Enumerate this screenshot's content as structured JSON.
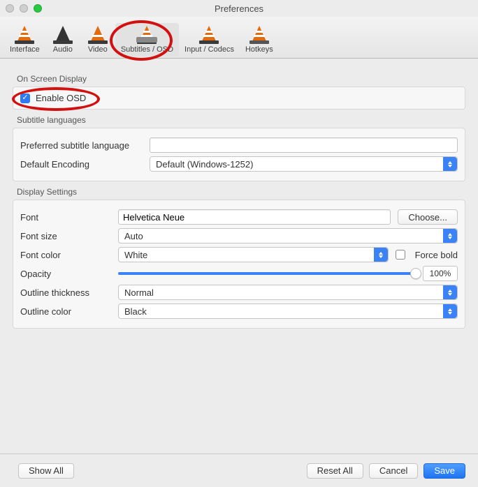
{
  "window": {
    "title": "Preferences"
  },
  "toolbar": {
    "items": [
      {
        "label": "Interface"
      },
      {
        "label": "Audio"
      },
      {
        "label": "Video"
      },
      {
        "label": "Subtitles / OSD"
      },
      {
        "label": "Input / Codecs"
      },
      {
        "label": "Hotkeys"
      }
    ],
    "selected_index": 3
  },
  "sections": {
    "osd": {
      "title": "On Screen Display",
      "enable_label": "Enable OSD",
      "enable_checked": true
    },
    "langs": {
      "title": "Subtitle languages",
      "pref_label": "Preferred subtitle language",
      "pref_value": "",
      "enc_label": "Default Encoding",
      "enc_value": "Default (Windows-1252)"
    },
    "display": {
      "title": "Display Settings",
      "font_label": "Font",
      "font_value": "Helvetica Neue",
      "choose_label": "Choose...",
      "size_label": "Font size",
      "size_value": "Auto",
      "color_label": "Font color",
      "color_value": "White",
      "force_bold_label": "Force bold",
      "force_bold_checked": false,
      "opacity_label": "Opacity",
      "opacity_pct": "100%",
      "thick_label": "Outline thickness",
      "thick_value": "Normal",
      "outcolor_label": "Outline color",
      "outcolor_value": "Black"
    }
  },
  "footer": {
    "show_all": "Show All",
    "reset_all": "Reset All",
    "cancel": "Cancel",
    "save": "Save"
  },
  "annotations": {
    "circle_toolbar": true,
    "circle_enable_osd": true
  }
}
